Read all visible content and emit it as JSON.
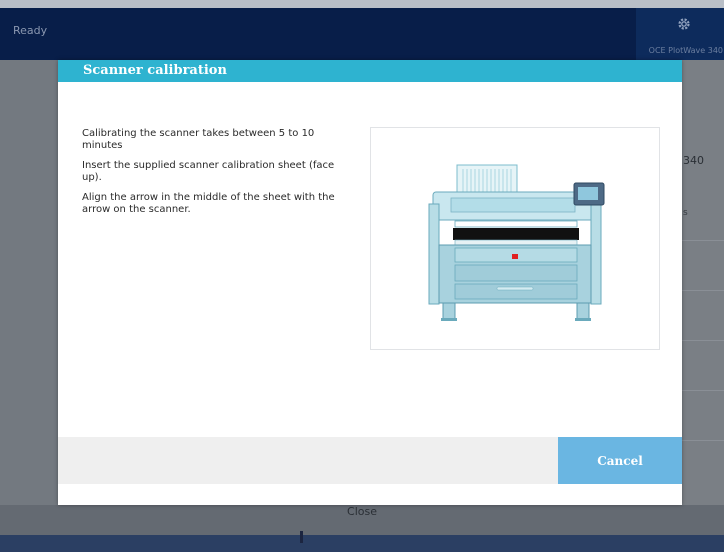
{
  "status_bar": {
    "status": "Ready",
    "device_name": "OCE PlotWave 340"
  },
  "background": {
    "right_text": "340",
    "right_subtext": "s",
    "close_label": "Close"
  },
  "dialog": {
    "title": "Scanner calibration",
    "instructions": [
      "Calibrating the scanner takes between 5 to 10 minutes",
      "Insert the supplied scanner calibration sheet (face up).",
      "Align the arrow in the middle of the sheet with the arrow on the scanner."
    ],
    "cancel_label": "Cancel"
  },
  "colors": {
    "header": "#2eb3d0",
    "cancel": "#6ab6e2",
    "topbar": "#081e49"
  },
  "icons": {
    "settings": "gear-icon",
    "illustration": "printer-scanner-illustration"
  }
}
